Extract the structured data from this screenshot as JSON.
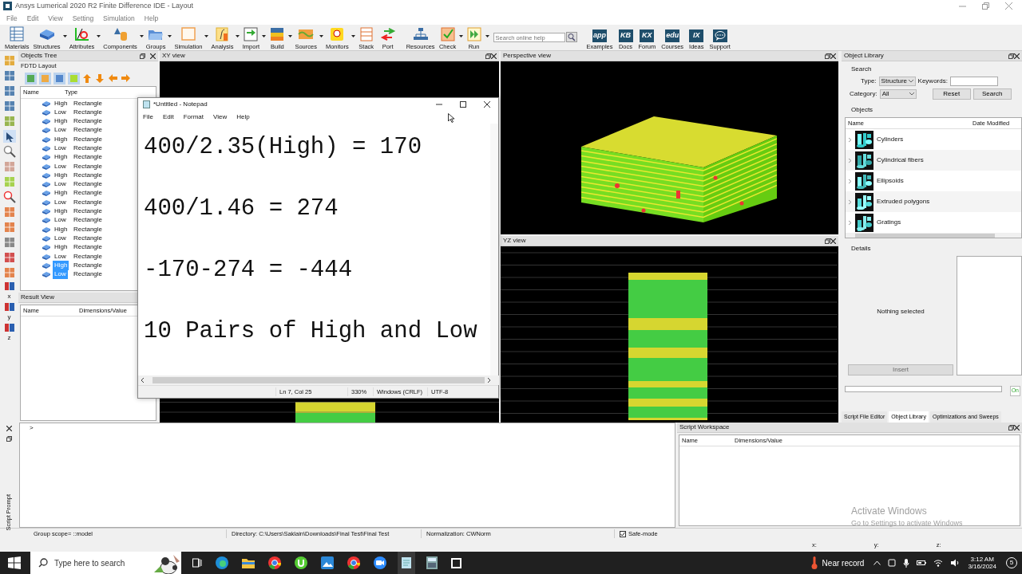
{
  "window": {
    "title": "Ansys Lumerical 2020 R2 Finite Difference IDE - Layout"
  },
  "menu": [
    "File",
    "Edit",
    "View",
    "Setting",
    "Simulation",
    "Help"
  ],
  "toolbar": {
    "items": [
      {
        "label": "Materials",
        "kind": "table",
        "dropdown": false
      },
      {
        "label": "Structures",
        "kind": "block",
        "dropdown": true
      },
      {
        "label": "Attributes",
        "kind": "axes",
        "dropdown": true
      },
      {
        "label": "Components",
        "kind": "shapes",
        "dropdown": true
      },
      {
        "label": "Groups",
        "kind": "folder",
        "dropdown": true
      },
      {
        "label": "Simulation",
        "kind": "frame",
        "dropdown": true
      },
      {
        "label": "Analysis",
        "kind": "func",
        "dropdown": true
      },
      {
        "label": "Import",
        "kind": "import",
        "dropdown": true
      },
      {
        "label": "Build",
        "kind": "layers",
        "dropdown": true
      },
      {
        "label": "Sources",
        "kind": "wave",
        "dropdown": true
      },
      {
        "label": "Monitors",
        "kind": "bulb",
        "dropdown": true
      },
      {
        "label": "Stack",
        "kind": "stack",
        "dropdown": false
      },
      {
        "label": "Port",
        "kind": "arrows",
        "dropdown": false
      },
      {
        "label": "Resources",
        "kind": "tree",
        "dropdown": false
      },
      {
        "label": "Check",
        "kind": "check",
        "dropdown": true
      },
      {
        "label": "Run",
        "kind": "run",
        "dropdown": true
      }
    ],
    "search": {
      "placeholder": "Search online help"
    },
    "help_links": [
      {
        "label": "Examples",
        "badge": "app"
      },
      {
        "label": "Docs",
        "badge": "KB"
      },
      {
        "label": "Forum",
        "badge": "KX"
      },
      {
        "label": "Courses",
        "badge": "edu"
      },
      {
        "label": "Ideas",
        "badge": "IX"
      },
      {
        "label": "Support"
      }
    ]
  },
  "side_tools": {
    "axis_labels": [
      "x",
      "y",
      "z"
    ]
  },
  "objects_tree": {
    "title": "Objects Tree",
    "root": "FDTD Layout",
    "columns": [
      "Name",
      "Type"
    ],
    "rows": [
      {
        "name": "High",
        "type": "Rectangle",
        "selected": false
      },
      {
        "name": "Low",
        "type": "Rectangle",
        "selected": false
      },
      {
        "name": "High",
        "type": "Rectangle",
        "selected": false
      },
      {
        "name": "Low",
        "type": "Rectangle",
        "selected": false
      },
      {
        "name": "High",
        "type": "Rectangle",
        "selected": false
      },
      {
        "name": "Low",
        "type": "Rectangle",
        "selected": false
      },
      {
        "name": "High",
        "type": "Rectangle",
        "selected": false
      },
      {
        "name": "Low",
        "type": "Rectangle",
        "selected": false
      },
      {
        "name": "High",
        "type": "Rectangle",
        "selected": false
      },
      {
        "name": "Low",
        "type": "Rectangle",
        "selected": false
      },
      {
        "name": "High",
        "type": "Rectangle",
        "selected": false
      },
      {
        "name": "Low",
        "type": "Rectangle",
        "selected": false
      },
      {
        "name": "High",
        "type": "Rectangle",
        "selected": false
      },
      {
        "name": "Low",
        "type": "Rectangle",
        "selected": false
      },
      {
        "name": "High",
        "type": "Rectangle",
        "selected": false
      },
      {
        "name": "Low",
        "type": "Rectangle",
        "selected": false
      },
      {
        "name": "High",
        "type": "Rectangle",
        "selected": false
      },
      {
        "name": "Low",
        "type": "Rectangle",
        "selected": false
      },
      {
        "name": "High",
        "type": "Rectangle",
        "selected": true
      },
      {
        "name": "Low",
        "type": "Rectangle",
        "selected": true
      }
    ]
  },
  "result_view": {
    "title": "Result View",
    "columns": [
      "Name",
      "Dimensions/Value"
    ]
  },
  "xy_view": {
    "title": "XY view"
  },
  "perspective_view": {
    "title": "Perspective view"
  },
  "yz_view": {
    "title": "YZ view"
  },
  "notepad": {
    "title": "*Untitled - Notepad",
    "menu": [
      "File",
      "Edit",
      "Format",
      "View",
      "Help"
    ],
    "lines": [
      "400/2.35(High) = 170",
      "400/1.46 = 274",
      "-170-274 = -444",
      "10 Pairs of High and Low"
    ],
    "status": [
      "Ln 7, Col 25",
      "330%",
      "Windows (CRLF)",
      "UTF-8"
    ]
  },
  "object_library": {
    "title": "Object Library",
    "search_label": "Search",
    "type_label": "Type:",
    "type_value": "Structure",
    "keywords_label": "Keywords:",
    "category_label": "Category:",
    "category_value": "All",
    "buttons": [
      "Reset",
      "Search"
    ],
    "objects_label": "Objects",
    "columns": [
      "Name",
      "Date Modified"
    ],
    "items": [
      {
        "name": "Cylinders",
        "kind": "picture"
      },
      {
        "name": "Cylindrical fibers",
        "kind": "picture"
      },
      {
        "name": "Ellipsoids",
        "kind": "picture"
      },
      {
        "name": "Extruded polygons",
        "kind": "picture"
      },
      {
        "name": "Gratings",
        "kind": "picture"
      }
    ],
    "details_label": "Details",
    "details_text": "Nothing selected",
    "insert": {
      "label": "Insert",
      "disabled": true
    },
    "status_text": "On"
  },
  "dock_tabs": [
    {
      "label": "Script File Editor",
      "selected": false
    },
    {
      "label": "Object Library",
      "selected": true
    },
    {
      "label": "Optimizations and Sweeps",
      "selected": false
    }
  ],
  "script_prompt": {
    "title": "Script Prompt",
    "prompt": ">"
  },
  "script_workspace": {
    "title": "Script Workspace",
    "columns": [
      "Name",
      "Dimensions/Value"
    ]
  },
  "status_bar": {
    "group_scope": "Group scope= ::model",
    "directory": "Directory: C:\\Users\\Saklain\\Downloads\\Final Test\\Final Test",
    "normalization": "Normalization: CWNorm",
    "safe_mode": {
      "label": "Safe-mode",
      "checked": true
    },
    "coords": [
      "x:",
      "y:",
      "z:"
    ]
  },
  "activation": {
    "title": "Activate Windows",
    "text": "Go to Settings to activate Windows"
  },
  "taskbar": {
    "search_placeholder": "Type here to search",
    "weather": "Near record",
    "time": "3:12 AM",
    "date": "3/16/2024",
    "notifications": "5"
  }
}
